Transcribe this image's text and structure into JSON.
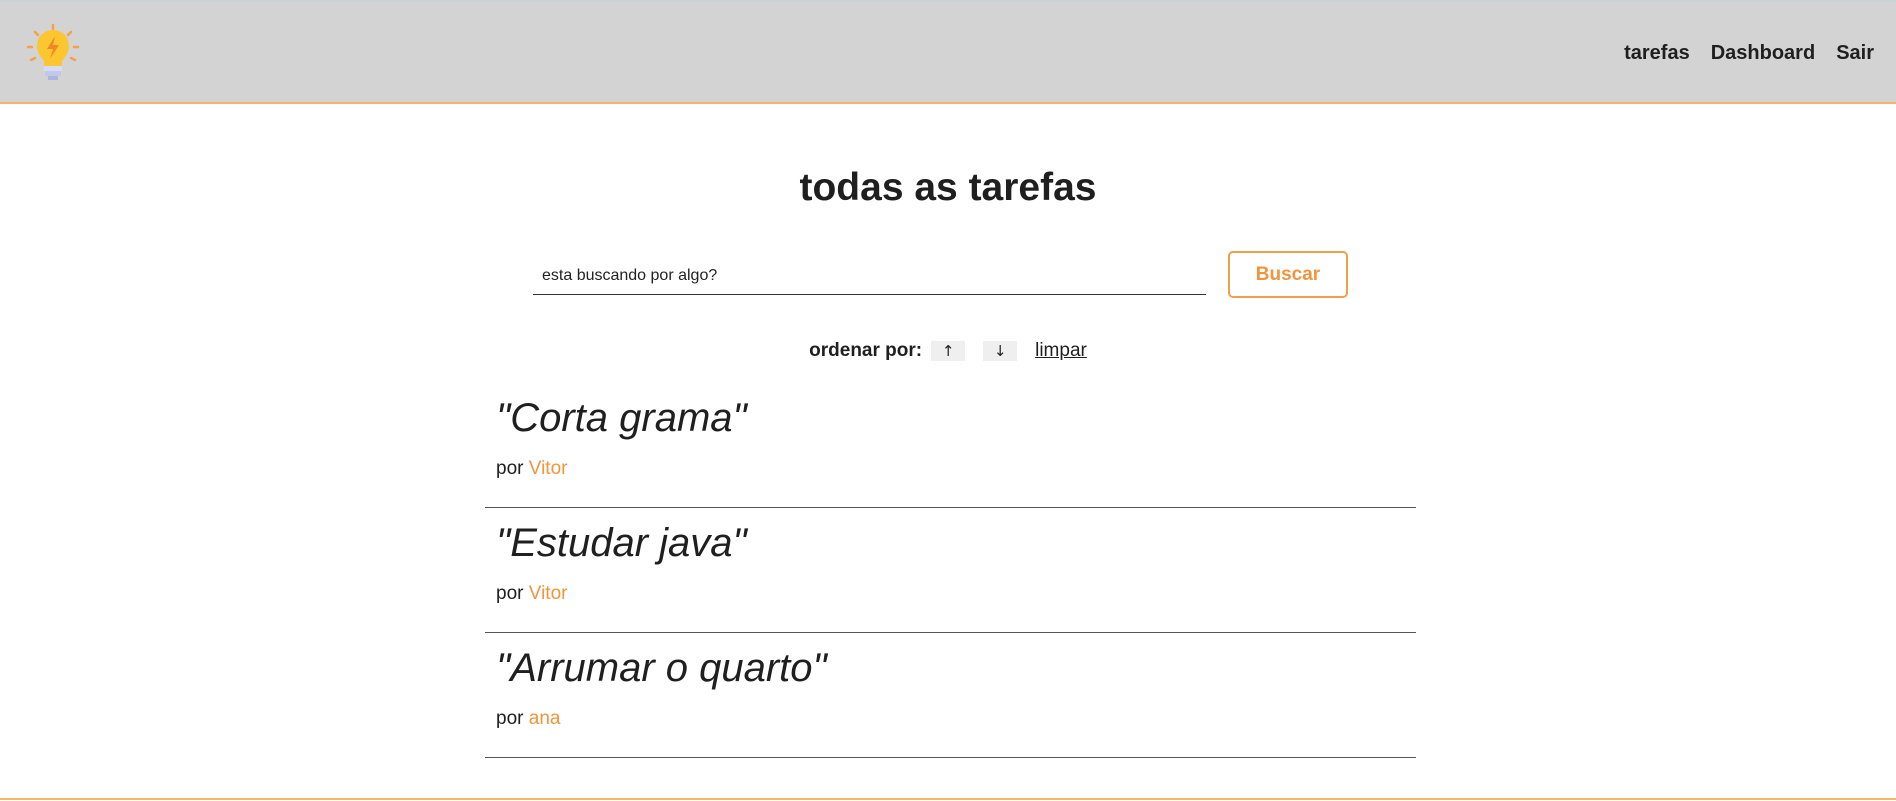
{
  "navbar": {
    "logo_icon": "lightbulb-icon",
    "links": [
      {
        "label": "tarefas"
      },
      {
        "label": "Dashboard"
      },
      {
        "label": "Sair"
      }
    ]
  },
  "main": {
    "title": "todas as tarefas",
    "search": {
      "placeholder": "esta buscando por algo?",
      "value": "",
      "button_label": "Buscar"
    },
    "sort": {
      "label": "ordenar por:",
      "asc_label": "↑",
      "desc_label": "↓",
      "clear_label": "limpar"
    },
    "tasks": [
      {
        "title": "\"Corta grama\"",
        "by": "por",
        "author": "Vitor"
      },
      {
        "title": "\"Estudar java\"",
        "by": "por",
        "author": "Vitor"
      },
      {
        "title": "\"Arrumar o quarto\"",
        "by": "por",
        "author": "ana"
      }
    ]
  },
  "colors": {
    "accent": "#f0953b",
    "navbar_bg": "#d3d3d3",
    "border_accent": "#f5b468"
  }
}
